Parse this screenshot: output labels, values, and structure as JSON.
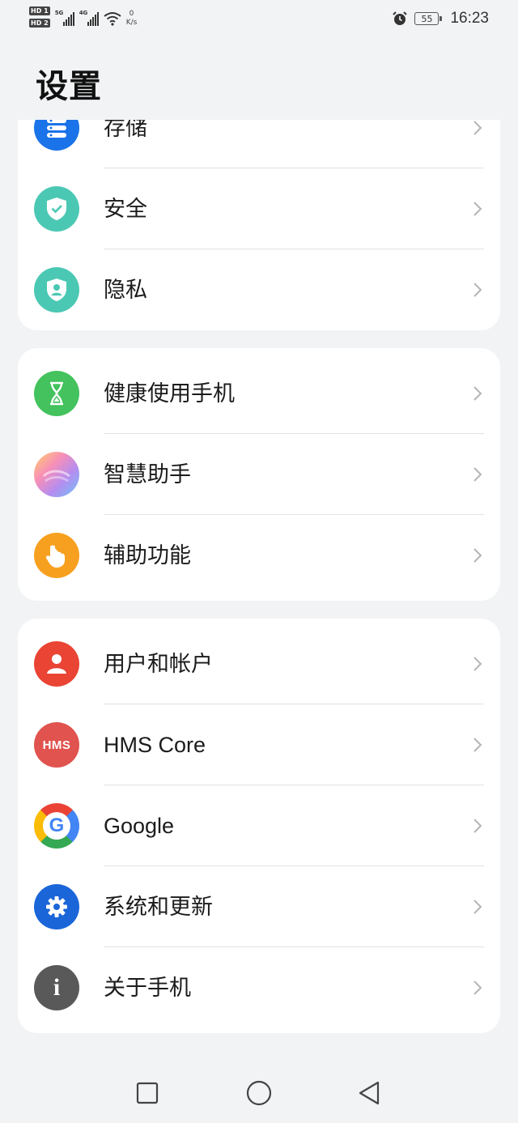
{
  "status_bar": {
    "hd1": "HD 1",
    "hd2": "HD 2",
    "network1": "5G",
    "network2": "4G",
    "speed_value": "0",
    "speed_unit": "K/s",
    "battery": "55",
    "time": "16:23"
  },
  "page": {
    "title": "设置"
  },
  "groups": [
    {
      "items": [
        {
          "label": "存储",
          "icon": "storage-icon",
          "color": "#1a73e8"
        },
        {
          "label": "安全",
          "icon": "shield-icon",
          "color": "#4bc8b4"
        },
        {
          "label": "隐私",
          "icon": "privacy-icon",
          "color": "#4bc8b4"
        }
      ]
    },
    {
      "items": [
        {
          "label": "健康使用手机",
          "icon": "hourglass-icon",
          "color": "#43c25d"
        },
        {
          "label": "智慧助手",
          "icon": "assistant-icon",
          "color": "#f3a6c8"
        },
        {
          "label": "辅助功能",
          "icon": "hand-icon",
          "color": "#f7a01f"
        }
      ]
    },
    {
      "items": [
        {
          "label": "用户和帐户",
          "icon": "user-icon",
          "color": "#e94434"
        },
        {
          "label": "HMS Core",
          "icon": "hms-icon",
          "icon_text": "HMS",
          "color": "#e0534f"
        },
        {
          "label": "Google",
          "icon": "google-icon",
          "icon_text": "G",
          "color": "#4285f4"
        },
        {
          "label": "系统和更新",
          "icon": "gear-icon",
          "color": "#1a66d9"
        },
        {
          "label": "关于手机",
          "icon": "info-icon",
          "icon_text": "i",
          "color": "#595959"
        }
      ]
    }
  ],
  "nav": {
    "recents": "recents-square-icon",
    "home": "home-circle-icon",
    "back": "back-triangle-icon"
  }
}
